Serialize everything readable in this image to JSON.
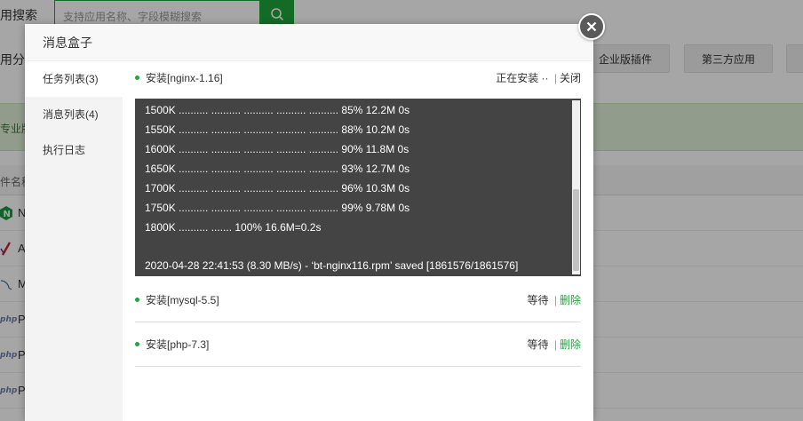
{
  "background": {
    "search_label": "用搜索",
    "search_placeholder": "支持应用名称、字段模糊搜索",
    "category_label": "用分类",
    "buttons": [
      "企业版插件",
      "第三方应用"
    ],
    "banner_text": "专业版",
    "table_header": "件名称",
    "rows": [
      {
        "icon": "nginx-icon",
        "name": "N"
      },
      {
        "icon": "apache-icon",
        "name": "A"
      },
      {
        "icon": "mysql-icon",
        "name": "M"
      },
      {
        "icon": "php-icon",
        "icon_text": "php",
        "name": "P"
      },
      {
        "icon": "php-icon",
        "icon_text": "php",
        "name": "P"
      },
      {
        "icon": "php-icon",
        "icon_text": "php",
        "name": "P"
      }
    ]
  },
  "modal": {
    "title": "消息盒子",
    "sidebar": [
      {
        "label": "任务列表(3)",
        "active": true
      },
      {
        "label": "消息列表(4)",
        "active": false
      },
      {
        "label": "执行日志",
        "active": false
      }
    ],
    "tasks": [
      {
        "name": "安装[nginx-1.16]",
        "status": "正在安装 ··",
        "action": "关闭",
        "console_lines": [
          "1500K .......... .......... .......... .......... .......... 85% 12.2M 0s",
          "1550K .......... .......... .......... .......... .......... 88% 10.2M 0s",
          "1600K .......... .......... .......... .......... .......... 90% 11.8M 0s",
          "1650K .......... .......... .......... .......... .......... 93% 12.7M 0s",
          "1700K .......... .......... .......... .......... .......... 96% 10.3M 0s",
          "1750K .......... .......... .......... .......... .......... 99% 9.78M 0s",
          "1800K .......... ....... 100% 16.6M=0.2s"
        ],
        "console_last": "2020-04-28 22:41:53 (8.30 MB/s) - ‘bt-nginx116.rpm’ saved [1861576/1861576]"
      },
      {
        "name": "安装[mysql-5.5]",
        "status": "等待",
        "action": "删除"
      },
      {
        "name": "安装[php-7.3]",
        "status": "等待",
        "action": "删除"
      }
    ]
  },
  "colors": {
    "accent": "#20a53a",
    "console_bg": "#444444"
  }
}
